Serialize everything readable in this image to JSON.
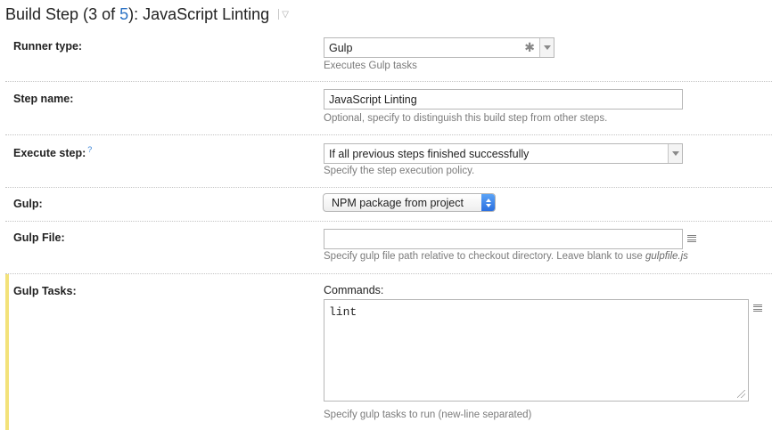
{
  "header": {
    "title_prefix": "Build Step (",
    "step_current": "3",
    "of_text": " of ",
    "step_total": "5",
    "title_suffix": "): JavaScript Linting"
  },
  "runner_type": {
    "label": "Runner type:",
    "value": "Gulp",
    "hint": "Executes Gulp tasks",
    "icon": "asterisk-icon"
  },
  "step_name": {
    "label": "Step name:",
    "value": "JavaScript Linting",
    "hint": "Optional, specify to distinguish this build step from other steps."
  },
  "execute_step": {
    "label": "Execute step:",
    "help": "?",
    "value": "If all previous steps finished successfully",
    "hint": "Specify the step execution policy."
  },
  "gulp": {
    "label": "Gulp:",
    "value": "NPM package from project"
  },
  "gulp_file": {
    "label": "Gulp File:",
    "value": "",
    "hint_prefix": "Specify gulp file path relative to checkout directory. Leave blank to use ",
    "hint_em": "gulpfile.js"
  },
  "gulp_tasks": {
    "label": "Gulp Tasks:",
    "commands_label": "Commands:",
    "value": "lint",
    "hint": "Specify gulp tasks to run (new-line separated)"
  },
  "colors": {
    "link": "#2a71c4",
    "highlight": "#f3e27a",
    "mac_select_accent": "#2a6fe0"
  }
}
